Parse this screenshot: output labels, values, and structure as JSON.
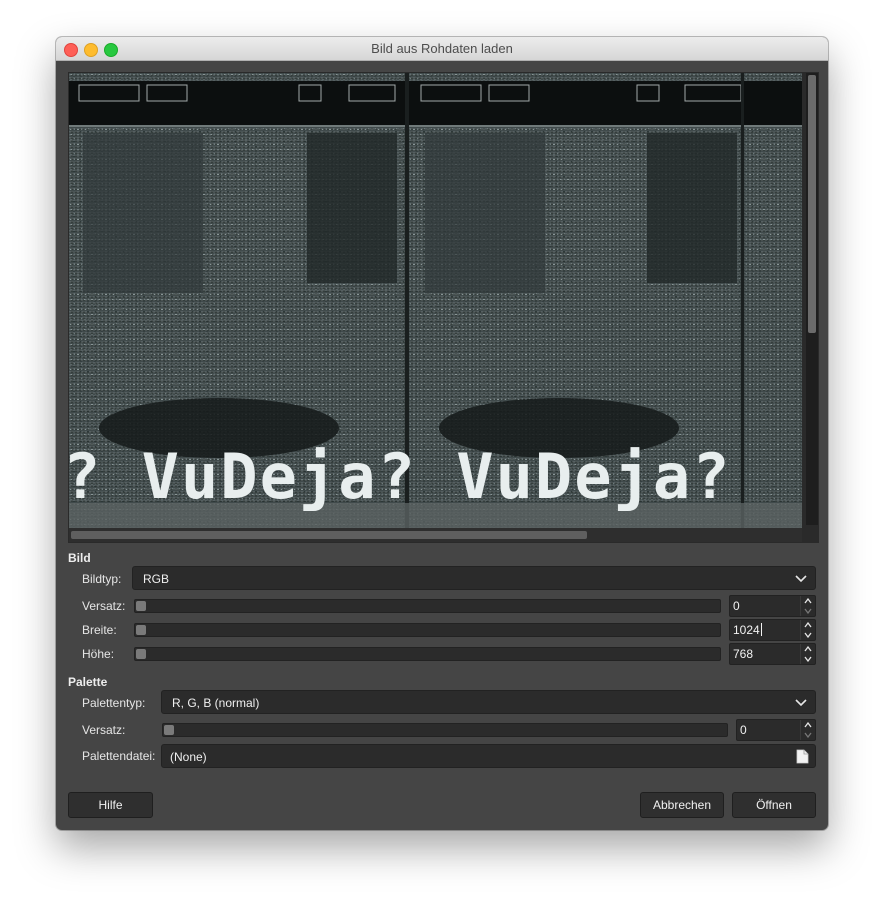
{
  "window": {
    "title": "Bild aus Rohdaten laden"
  },
  "preview": {
    "text": "? VuDeja? VuDeja?"
  },
  "image_section": {
    "heading": "Bild",
    "image_type": {
      "label": "Bildtyp:",
      "value": "RGB"
    },
    "offset": {
      "label": "Versatz:",
      "value": "0"
    },
    "width": {
      "label": "Breite:",
      "value": "1024"
    },
    "height": {
      "label": "Höhe:",
      "value": "768"
    }
  },
  "palette_section": {
    "heading": "Palette",
    "palette_type": {
      "label": "Palettentyp:",
      "value": "R, G, B (normal)"
    },
    "offset": {
      "label": "Versatz:",
      "value": "0"
    },
    "palette_file": {
      "label": "Palettendatei:",
      "value": "(None)"
    }
  },
  "buttons": {
    "help": "Hilfe",
    "cancel": "Abbrechen",
    "open": "Öffnen"
  },
  "colors": {
    "dialog_bg": "#454545",
    "field_bg": "#2b2b2b",
    "accent_text": "#f0f0f0"
  },
  "icons": {
    "dropdown": "chevron-down-icon",
    "file": "document-open-icon"
  }
}
